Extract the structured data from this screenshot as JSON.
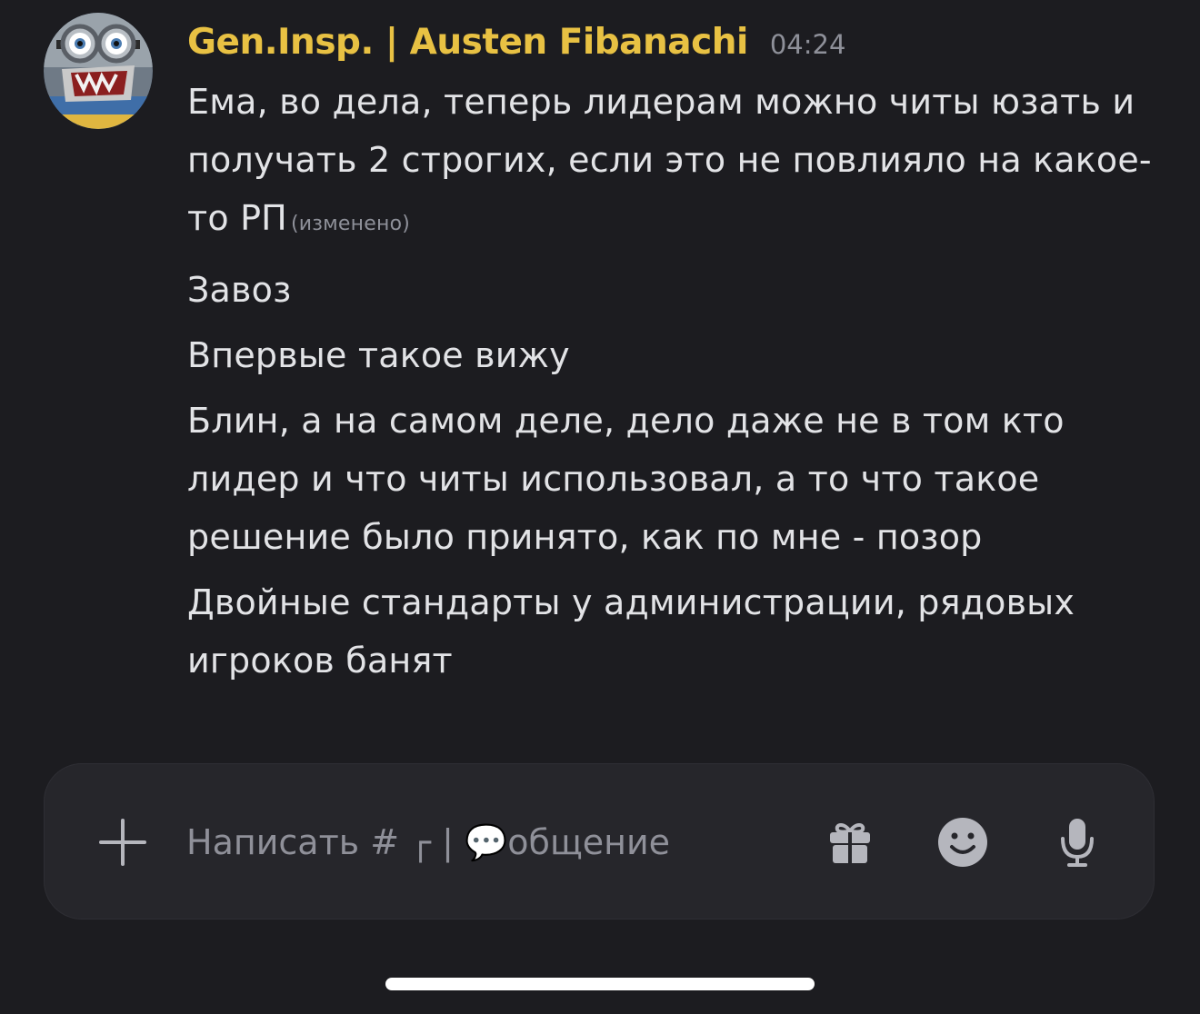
{
  "message": {
    "author": "Gen.Insp. | Austen Fibanachi",
    "timestamp": "04:24",
    "author_color": "#e8c143",
    "lines": [
      {
        "text": "Ема, во дела, теперь лидерам можно читы юзать и получать 2 строгих, если это не повлияло на какое-то РП",
        "edited_label": "(изменено)"
      },
      {
        "text": "Завоз"
      },
      {
        "text": "Впервые такое вижу"
      },
      {
        "text": "Блин, а на самом деле, дело даже не в том кто лидер и что читы использовал, а то что такое решение было принято, как по мне - позор"
      },
      {
        "text": "Двойные стандарты у администрации, рядовых игроков банят"
      }
    ]
  },
  "composer": {
    "placeholder": "Написать # ┌ | 💬общение",
    "plus_icon": "plus-icon",
    "gift_icon": "gift-icon",
    "emoji_icon": "emoji-icon",
    "mic_icon": "microphone-icon"
  },
  "colors": {
    "background": "#1c1c20",
    "composer_bg": "#26262b",
    "text": "#e2e3e6",
    "muted": "#8e9099",
    "icon": "#b5b6bd"
  }
}
